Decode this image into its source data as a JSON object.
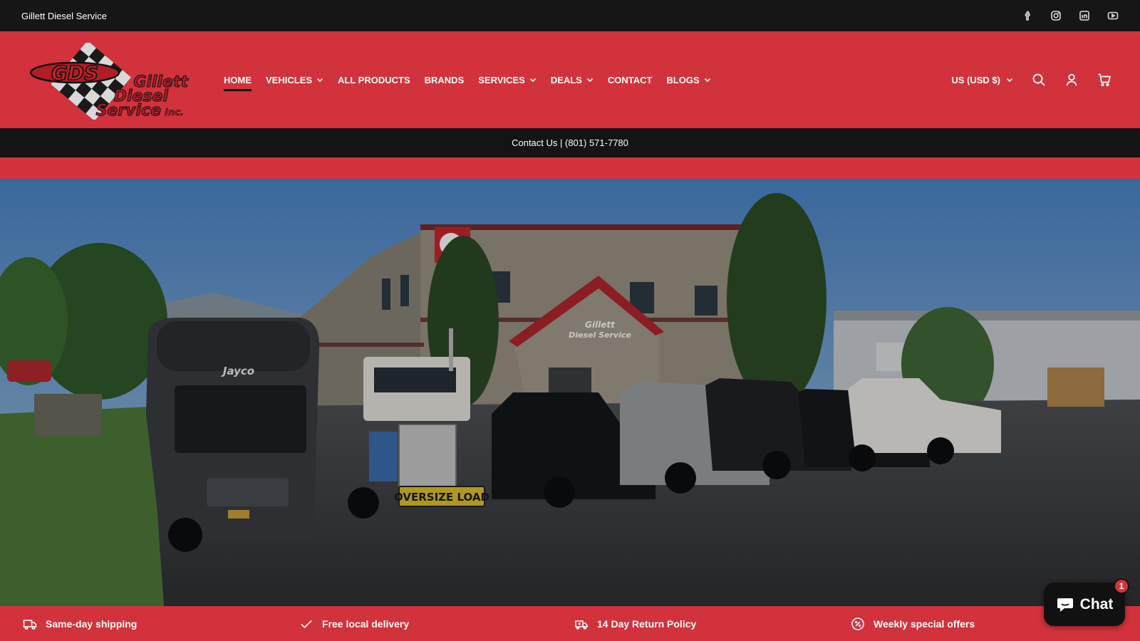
{
  "topbar": {
    "store_name": "Gillett Diesel Service",
    "social_icons": [
      "facebook-icon",
      "instagram-icon",
      "linkedin-icon",
      "youtube-icon"
    ]
  },
  "header": {
    "logo": {
      "mark": "GDS",
      "line1": "Gillett",
      "line2": "Diesel",
      "line3": "Service",
      "suffix": "Inc."
    },
    "nav": [
      {
        "label": "HOME",
        "active": true,
        "dropdown": false
      },
      {
        "label": "VEHICLES",
        "active": false,
        "dropdown": true
      },
      {
        "label": "ALL PRODUCTS",
        "active": false,
        "dropdown": false
      },
      {
        "label": "BRANDS",
        "active": false,
        "dropdown": false
      },
      {
        "label": "SERVICES",
        "active": false,
        "dropdown": true
      },
      {
        "label": "DEALS",
        "active": false,
        "dropdown": true
      },
      {
        "label": "CONTACT",
        "active": false,
        "dropdown": false
      },
      {
        "label": "BLOGS",
        "active": false,
        "dropdown": true
      }
    ],
    "currency": "US (USD $)",
    "icons": [
      "search-icon",
      "account-icon",
      "cart-icon"
    ]
  },
  "announcement": {
    "text": "Contact Us | (801) 571-7780"
  },
  "hero": {
    "building_sign_line1": "Gillett",
    "building_sign_line2": "Diesel Service",
    "rv_brand": "Jayco",
    "truck_banner": "OVERSIZE LOAD"
  },
  "features": [
    {
      "icon": "truck-icon",
      "label": "Same-day shipping"
    },
    {
      "icon": "check-icon",
      "label": "Free local delivery"
    },
    {
      "icon": "return-icon",
      "label": "14 Day Return Policy"
    },
    {
      "icon": "discount-icon",
      "label": "Weekly special offers"
    }
  ],
  "chat": {
    "label": "Chat",
    "badge": "1"
  },
  "colors": {
    "brand_red": "#d2323c",
    "dark": "#141414"
  }
}
